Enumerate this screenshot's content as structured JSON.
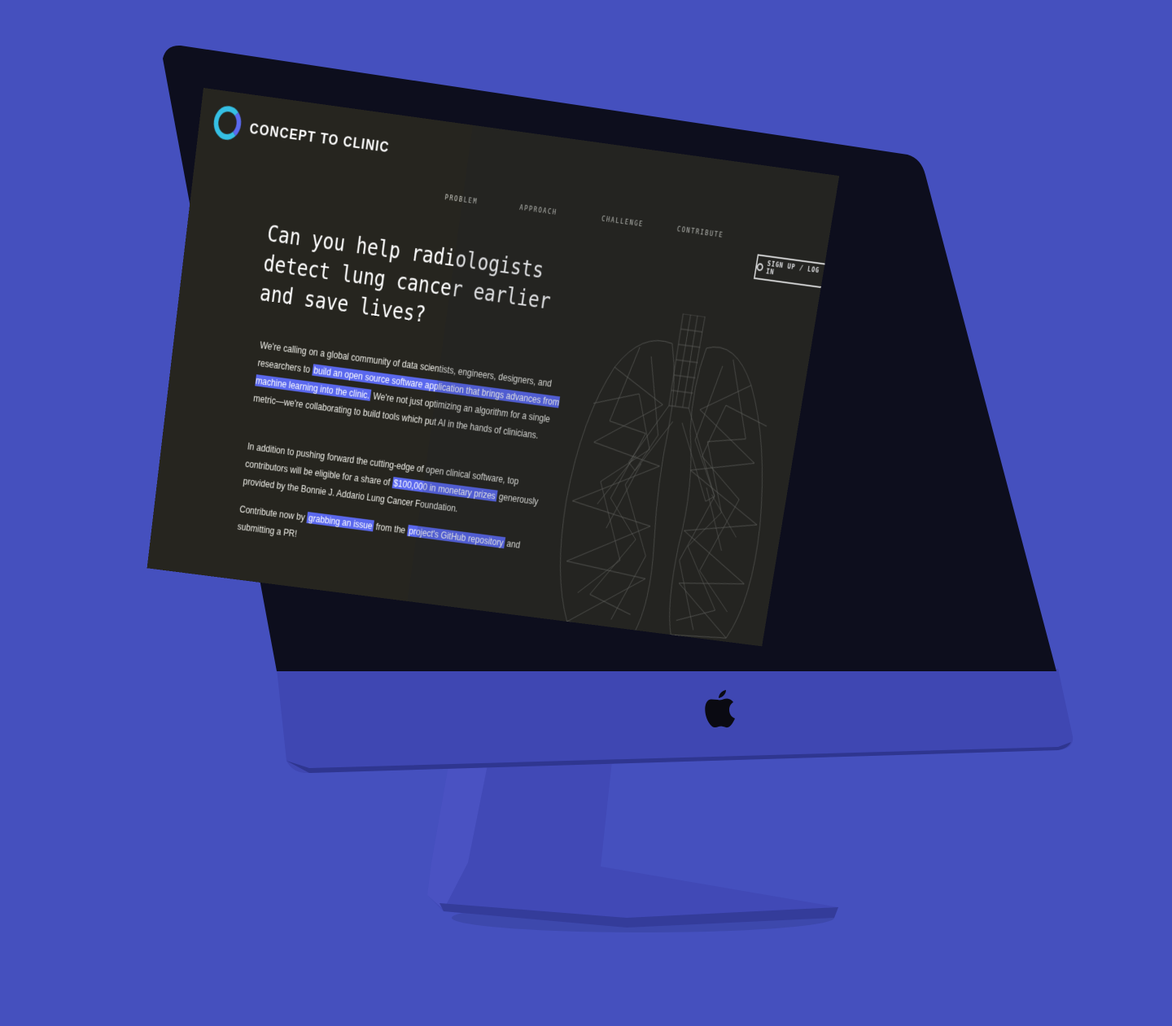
{
  "site": {
    "brand": "CONCEPT TO CLINIC"
  },
  "nav": {
    "items": [
      {
        "label": "PROBLEM"
      },
      {
        "label": "APPROACH"
      },
      {
        "label": "CHALLENGE"
      },
      {
        "label": "CONTRIBUTE"
      }
    ],
    "auth_label": "SIGN UP / LOG IN"
  },
  "hero": {
    "headline": "Can you help radiologists\ndetect lung cancer earlier\nand save lives?",
    "p1": {
      "before": "We're calling on a global community of data scientists, engineers, designers, and researchers to ",
      "link": "build an open source software application that brings advances from machine learning into the clinic.",
      "after": " We're not just optimizing an algorithm for a single metric—we're collaborating to build tools which put AI in the hands of clinicians."
    },
    "p2": {
      "before": "In addition to pushing forward the cutting-edge of open clinical software, top contributors will be eligible for a share of ",
      "link": "$100,000 in monetary prizes",
      "after": " generously provided by the Bonnie J. Addario Lung Cancer Foundation."
    },
    "p3": {
      "before": "Contribute now by ",
      "link1": "grabbing an issue",
      "middle": " from the ",
      "link2": "project's GitHub repository",
      "after": " and submitting a PR!"
    }
  },
  "icons": {
    "logo": "concept-to-clinic-ring-logo",
    "github": "github-icon",
    "apple": "apple-logo-icon"
  },
  "colors": {
    "background": "#4550be",
    "screen": "#26251f",
    "highlight": "#5a68ee",
    "logo_cyan": "#35c0e4"
  }
}
